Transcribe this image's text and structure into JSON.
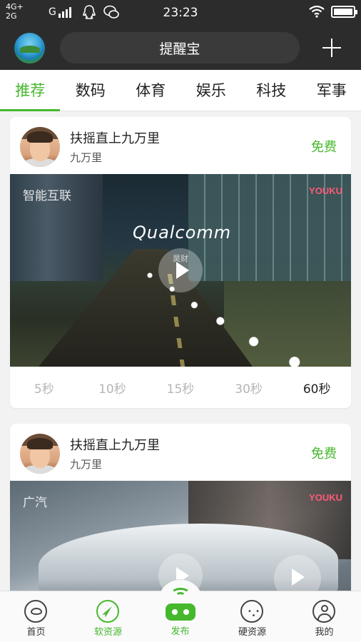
{
  "status_bar": {
    "network_top": "4G+",
    "network_bottom": "2G",
    "carrier": "G",
    "time": "23:23",
    "icons": [
      "qq-icon",
      "wechat-icon",
      "wifi-icon",
      "battery-icon"
    ]
  },
  "header": {
    "title": "提醒宝",
    "add_icon": "plus-icon"
  },
  "tabs": [
    {
      "label": "推荐",
      "active": true
    },
    {
      "label": "数码",
      "active": false
    },
    {
      "label": "体育",
      "active": false
    },
    {
      "label": "娱乐",
      "active": false
    },
    {
      "label": "科技",
      "active": false
    },
    {
      "label": "军事",
      "active": false
    }
  ],
  "cards": [
    {
      "author": "扶摇直上九万里",
      "subtitle": "九万里",
      "price": "免费",
      "video_caption": "智能互联",
      "video_brand": "Qualcomm",
      "watermark": "YOUKU",
      "play_label": "昊财",
      "durations": [
        "5秒",
        "10秒",
        "15秒",
        "30秒",
        "60秒"
      ],
      "selected_duration": "60秒"
    },
    {
      "author": "扶摇直上九万里",
      "subtitle": "九万里",
      "price": "免费",
      "video_caption": "广汽",
      "watermark": "YOUKU"
    }
  ],
  "bottom_nav": [
    {
      "label": "首页",
      "icon": "eye-icon"
    },
    {
      "label": "软资源",
      "icon": "compass-icon"
    },
    {
      "label": "发布",
      "icon": "robot-icon"
    },
    {
      "label": "硬资源",
      "icon": "chat-icon"
    },
    {
      "label": "我的",
      "icon": "user-icon"
    }
  ],
  "colors": {
    "accent": "#46b82e",
    "header_bg": "#2c2c2c",
    "page_bg": "#f2f2f2"
  }
}
